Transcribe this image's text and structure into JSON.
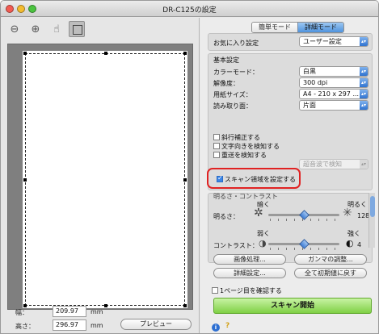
{
  "window": {
    "title": "DR-C125の設定"
  },
  "mode_tabs": {
    "simple": "簡単モード",
    "advanced": "詳細モード"
  },
  "favorites": {
    "label": "お気に入り設定",
    "value": "ユーザー設定"
  },
  "basic": {
    "section_title": "基本設定",
    "color_mode": {
      "label": "カラーモード：",
      "value": "白黒"
    },
    "resolution": {
      "label": "解像度：",
      "value": "300 dpi"
    },
    "paper_size": {
      "label": "用紙サイズ：",
      "value": "A4 - 210 x 297 ..."
    },
    "scan_side": {
      "label": "読み取り面：",
      "value": "片面"
    }
  },
  "options": {
    "deskew": "斜行補正する",
    "text_orientation": "文字向きを検知する",
    "double_feed": "重送を検知する",
    "double_feed_method": "超音波で検知",
    "scan_area": "スキャン領域を設定する"
  },
  "brightness_section": {
    "title": "明るさ・コントラスト",
    "brightness_label": "明るさ：",
    "dark": "暗く",
    "bright": "明るく",
    "brightness_value": "128",
    "contrast_label": "コントラスト：",
    "weak": "弱く",
    "strong": "強く",
    "contrast_value": "4"
  },
  "buttons": {
    "image_processing": "画像処理...",
    "gamma": "ガンマの調整...",
    "detail": "詳細設定...",
    "reset": "全て初期値に戻す",
    "preview": "プレビュー",
    "start": "スキャン開始"
  },
  "first_page": "1ページ目を確認する",
  "dimensions": {
    "width_label": "幅：",
    "width_value": "209.97",
    "height_label": "高さ：",
    "height_value": "296.97",
    "unit": "mm"
  }
}
